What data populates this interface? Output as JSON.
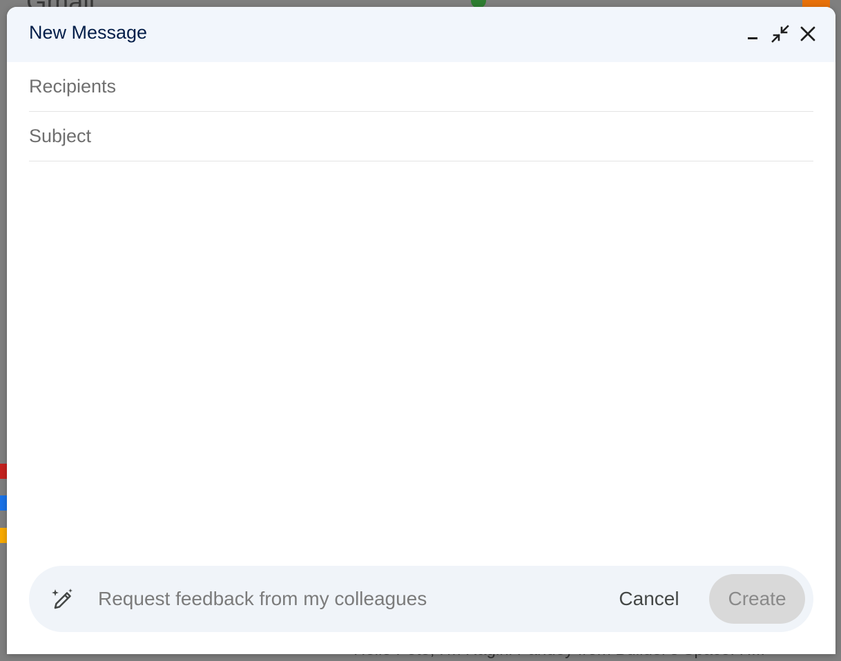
{
  "background": {
    "app_title": "Gmail",
    "snippet": "Hello Pete, I'm Ragini Pandey from Builder's Space. H..."
  },
  "dialog": {
    "title": "New Message",
    "minimize_icon": "minimize-icon",
    "exit_fullscreen_icon": "exit-fullscreen-icon",
    "close_icon": "close-icon"
  },
  "fields": {
    "recipients": {
      "value": "",
      "placeholder": "Recipients"
    },
    "subject": {
      "value": "",
      "placeholder": "Subject"
    }
  },
  "prompt_bar": {
    "icon": "magic-pencil-icon",
    "input_value": "",
    "input_placeholder": "Request feedback from my colleagues",
    "cancel_label": "Cancel",
    "create_label": "Create",
    "create_disabled": true
  },
  "colors": {
    "header_bg": "#f2f6fc",
    "title_text": "#041e49",
    "prompt_bar_bg": "#f0f4f9",
    "create_btn_disabled_bg": "#d9d9d9"
  }
}
